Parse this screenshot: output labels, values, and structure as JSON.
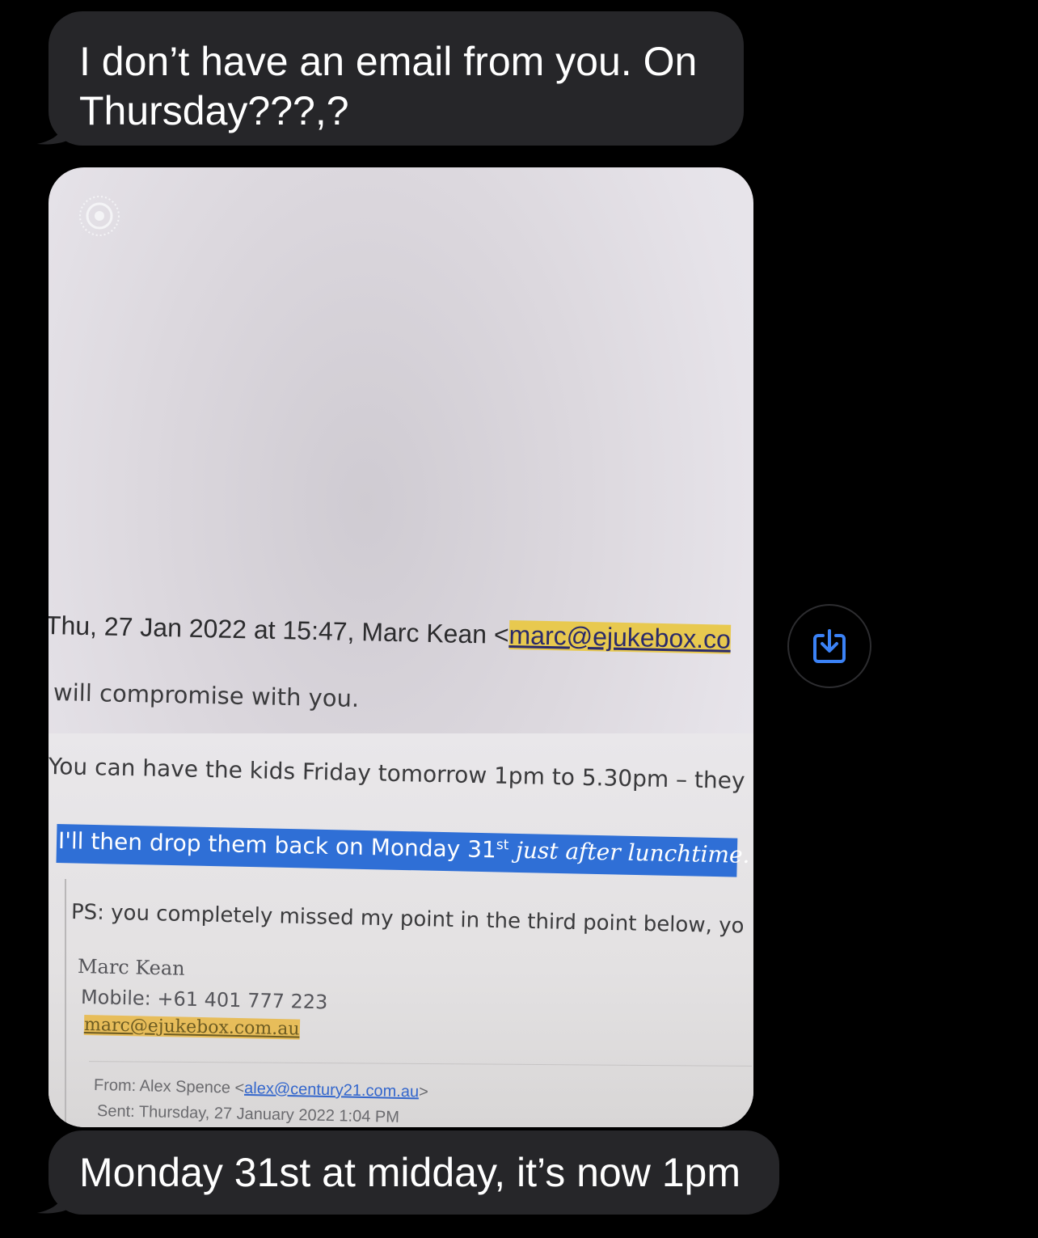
{
  "messages": {
    "incoming_1": "I don’t have an email from you. On Thursday???,?",
    "incoming_2": "Monday 31st at midday, it’s now 1pm"
  },
  "photo": {
    "live_photo_icon": "live-photo-icon",
    "email": {
      "header_prefix": "Thu, 27 Jan 2022 at 15:47, Marc Kean <",
      "header_link": "marc@ejukebox.co",
      "line1": "will compromise with you.",
      "line2": "You can have the kids Friday tomorrow 1pm to 5.30pm – they",
      "line3_main": "I'll then drop them back on Monday 31",
      "line3_sup": "st",
      "line3_rest": " just after lunchtime.",
      "ps": "PS: you completely missed my point in the third point below, yo",
      "sig_name": "Marc Kean",
      "sig_mobile": "Mobile: +61 401 777 223",
      "sig_email": "marc@ejukebox.com.au",
      "from_label": "From: Alex Spence <",
      "from_link": "alex@century21.com.au",
      "from_suffix": ">",
      "sent": "Sent: Thursday, 27 January 2022 1:04 PM"
    }
  },
  "save_button": {
    "icon": "save-download-icon",
    "color": "#3b82f6"
  },
  "colors": {
    "bubble": "#262629",
    "background": "#000000",
    "highlight": "#2f6fd6"
  }
}
